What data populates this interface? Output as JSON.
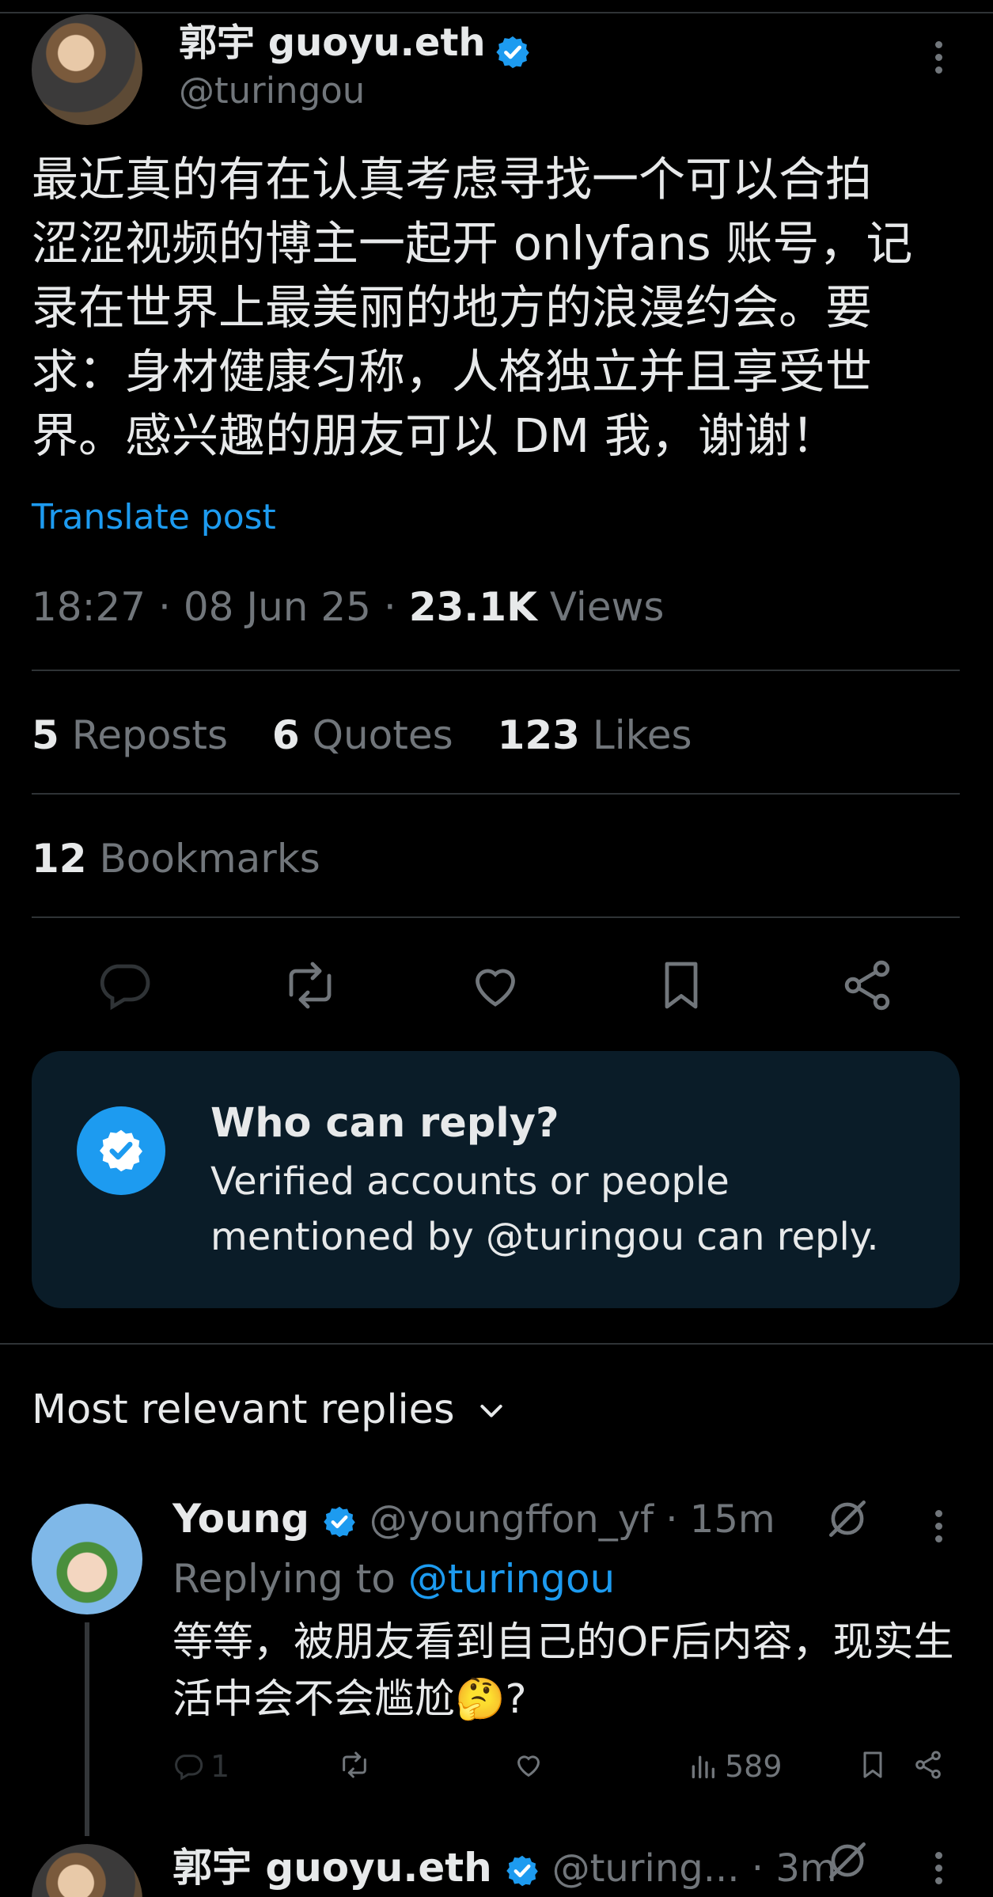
{
  "post": {
    "author_name": "郭宇 guoyu.eth",
    "author_handle": "@turingou",
    "text": "最近真的有在认真考虑寻找一个可以合拍\n涩涩视频的博主一起开 onlyfans 账号，记\n录在世界上最美丽的地方的浪漫约会。要\n求：身材健康匀称，人格独立并且享受世\n界。感兴趣的朋友可以 DM 我，谢谢！",
    "translate_label": "Translate post",
    "time": "18:27",
    "date": "08 Jun 25",
    "views_count": "23.1K",
    "views_label": "Views",
    "separator": "·"
  },
  "stats": {
    "reposts_count": "5",
    "reposts_label": "Reposts",
    "quotes_count": "6",
    "quotes_label": "Quotes",
    "likes_count": "123",
    "likes_label": "Likes",
    "bookmarks_count": "12",
    "bookmarks_label": "Bookmarks"
  },
  "actions": [
    "reply-icon",
    "repost-icon",
    "like-icon",
    "bookmark-icon",
    "share-icon"
  ],
  "reply_card": {
    "title": "Who can reply?",
    "body": "Verified accounts or people mentioned by @turingou can reply."
  },
  "replies_section": {
    "sort_label": "Most relevant replies"
  },
  "reply1": {
    "name": "Young",
    "handle": "@youngffon_yf",
    "time": "15m",
    "replying_prefix": "Replying to",
    "replying_handle": "@turingou",
    "text": "等等，被朋友看到自己的OF后内容，现实生活中会不会尴尬🤔?",
    "reply_count": "1",
    "views": "589"
  },
  "reply2": {
    "name": "郭宇 guoyu.eth",
    "handle": "@turing...",
    "time": "3m"
  },
  "colors": {
    "background": "#000000",
    "accent": "#1d9bf0",
    "muted": "#71767b",
    "card": "#0a1c28"
  }
}
